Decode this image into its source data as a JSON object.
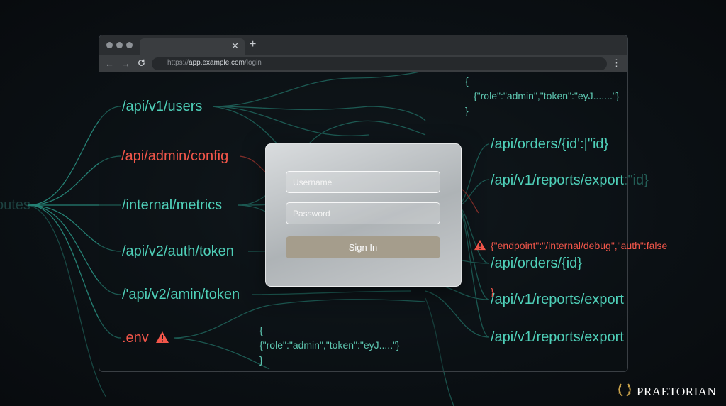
{
  "background_label": "outes",
  "browser": {
    "url_prefix": "https://",
    "url_host": "app.example.com",
    "url_path": "/login",
    "tab_close_icon": "close-icon",
    "new_tab_symbol": "+",
    "back_symbol": "←",
    "forward_symbol": "→",
    "reload_symbol": "C",
    "menu_symbol": "⋮"
  },
  "left_routes": [
    {
      "label": "/api/v1/users",
      "status": "ok"
    },
    {
      "label": "/api/admin/config",
      "status": "vulnerable"
    },
    {
      "label": "/internal/metrics",
      "status": "ok"
    },
    {
      "label": "/api/v2/auth/token",
      "status": "ok"
    },
    {
      "label": "/'api/v2/amin/token",
      "status": "ok"
    },
    {
      "label": ".env",
      "status": "vulnerable",
      "icon": "warning-icon"
    }
  ],
  "right_routes": [
    {
      "label": "/api/orders/{id':|\"id}"
    },
    {
      "label": "/api/v1/reports/export",
      "overlay": ":\"id}"
    },
    {
      "label": "/api/orders/{id}"
    },
    {
      "label": "/api/v1/reports/export"
    },
    {
      "label": "/api/v1/reports/export"
    }
  ],
  "json_top": {
    "open": "{",
    "body": "{\"role\":\"admin\",\"token\":\"eyJ.......\"}",
    "close": "}"
  },
  "json_bottom": {
    "open": "{",
    "body": "{\"role\":\"admin\",\"token\":\"eyJ.....\"}",
    "close": "}"
  },
  "json_alert": {
    "body": "{\"endpoint\":\"/internal/debug\",\"auth\":false",
    "close": "}",
    "icon": "warning-icon"
  },
  "login": {
    "username_placeholder": "Username",
    "password_placeholder": "Password",
    "submit_label": "Sign In"
  },
  "brand": {
    "name": "PRAETORIAN",
    "logo_icon": "laurel-wreath-icon"
  },
  "colors": {
    "route": "#4fd0b9",
    "alert": "#f2564a",
    "button": "#a59d8c",
    "background": "#0c1115"
  }
}
